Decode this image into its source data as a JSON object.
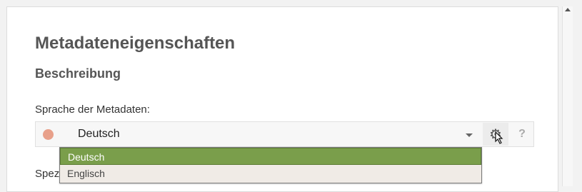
{
  "page_title": "Metadateneigenschaften",
  "section_title": "Beschreibung",
  "language_field": {
    "label": "Sprache der Metadaten:",
    "selected_value": "Deutsch",
    "status_color": "#e8a08a",
    "gear_icon": "gear-icon",
    "help_label": "?",
    "options": [
      "Deutsch",
      "Englisch"
    ],
    "highlighted_option": "Deutsch"
  },
  "next_field_label_visible": "Spez",
  "colors": {
    "selected_option_bg": "#7a9e4b",
    "list_bg": "#f0ebe6"
  }
}
